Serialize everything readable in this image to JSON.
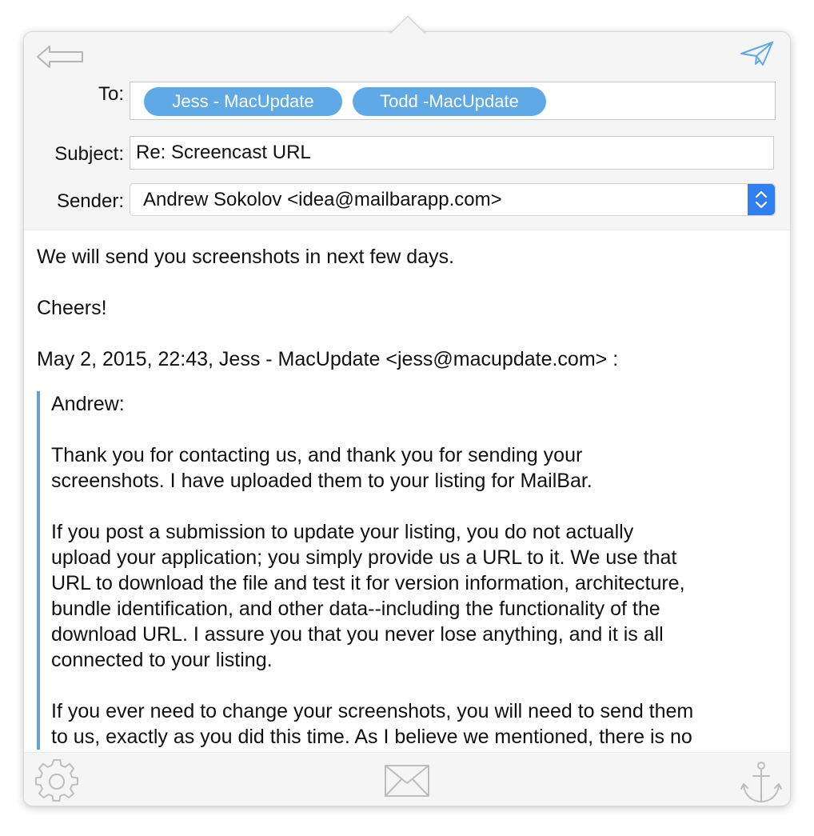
{
  "header": {
    "to_label": "To:",
    "subject_label": "Subject:",
    "sender_label": "Sender:",
    "recipients": [
      "Jess - MacUpdate",
      "Todd -MacUpdate"
    ],
    "subject_value": "Re: Screencast URL",
    "sender_value": "Andrew Sokolov <idea@mailbarapp.com>"
  },
  "icons": {
    "back": "back-arrow-icon",
    "send": "paper-plane-icon",
    "settings": "gear-icon",
    "compose": "envelope-icon",
    "pin": "anchor-icon"
  },
  "colors": {
    "token_bg": "#5fa9e6",
    "stepper_bg": "#2f7ff0",
    "quote_bar": "#6b9fcf",
    "send_icon": "#5fa9e6"
  },
  "message": {
    "line1": "We will send you screenshots in next few days.",
    "line2": "Cheers!",
    "line3": "May 2, 2015, 22:43, Jess - MacUpdate <jess@macupdate.com> :",
    "quote": {
      "greeting": "Andrew:",
      "para1": "Thank you for contacting us, and thank you for sending your\nscreenshots. I have uploaded them to your listing for MailBar.",
      "para2": "If you post a submission to update your listing, you do not actually\nupload your application; you simply provide us a URL to it. We use that\nURL to download the file and test it for version information, architecture,\nbundle identification, and other data--including the functionality of the\ndownload URL. I assure you that you never lose anything, and it is all\nconnected to your listing.",
      "para3": "If you ever need to change your screenshots, you will need to send them\nto us, exactly as you did this time. As I believe we mentioned, there is no"
    }
  }
}
